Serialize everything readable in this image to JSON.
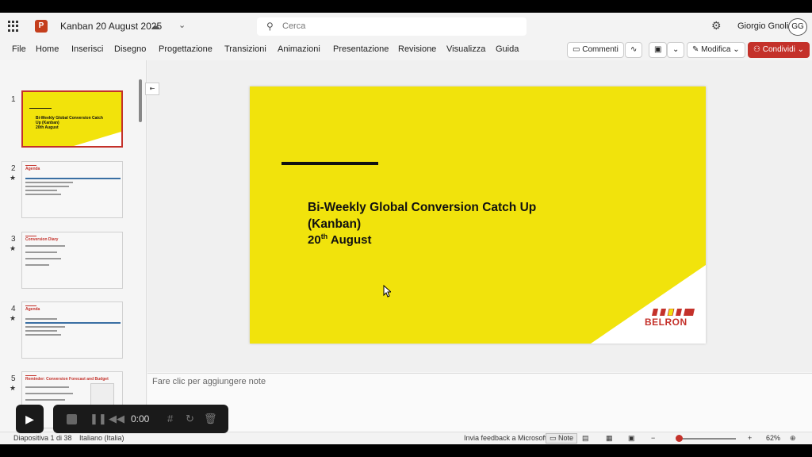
{
  "titlebar": {
    "doc_title": "Kanban 20 August 2025",
    "search_placeholder": "Cerca",
    "user_name": "Giorgio Gnoli",
    "user_initials": "GG"
  },
  "ribbon": {
    "tabs": [
      "File",
      "Home",
      "Inserisci",
      "Disegno",
      "Progettazione",
      "Transizioni",
      "Animazioni",
      "Presentazione",
      "Revisione",
      "Visualizza",
      "Guida"
    ],
    "comments_label": "Commenti",
    "edit_label": "Modifica",
    "share_label": "Condividi"
  },
  "thumbnails": [
    {
      "num": "1",
      "title": "Bi-Weekly Global Conversion Catch Up (Kanban)",
      "subtitle": "20th August"
    },
    {
      "num": "2",
      "title": "Agenda"
    },
    {
      "num": "3",
      "title": "Conversion Diary"
    },
    {
      "num": "4",
      "title": "Agenda"
    },
    {
      "num": "5",
      "title": "Reminder: Conversion Forecast and Budget"
    }
  ],
  "slide": {
    "title_line1": "Bi-Weekly Global Conversion Catch Up",
    "title_line2": "(Kanban)",
    "date_day": "20",
    "date_suffix": "th",
    "date_month": "August",
    "logo_text": "BELRON"
  },
  "notes": {
    "placeholder": "Fare clic per aggiungere note"
  },
  "recorder": {
    "time": "0:00"
  },
  "status": {
    "slide_info": "Diapositiva 1 di 38",
    "language": "Italiano (Italia)",
    "feedback": "Invia feedback a Microsoft",
    "notes_label": "Note",
    "zoom": "62%"
  },
  "colors": {
    "accent": "#c4312a",
    "slide_yellow": "#f1e30c"
  }
}
